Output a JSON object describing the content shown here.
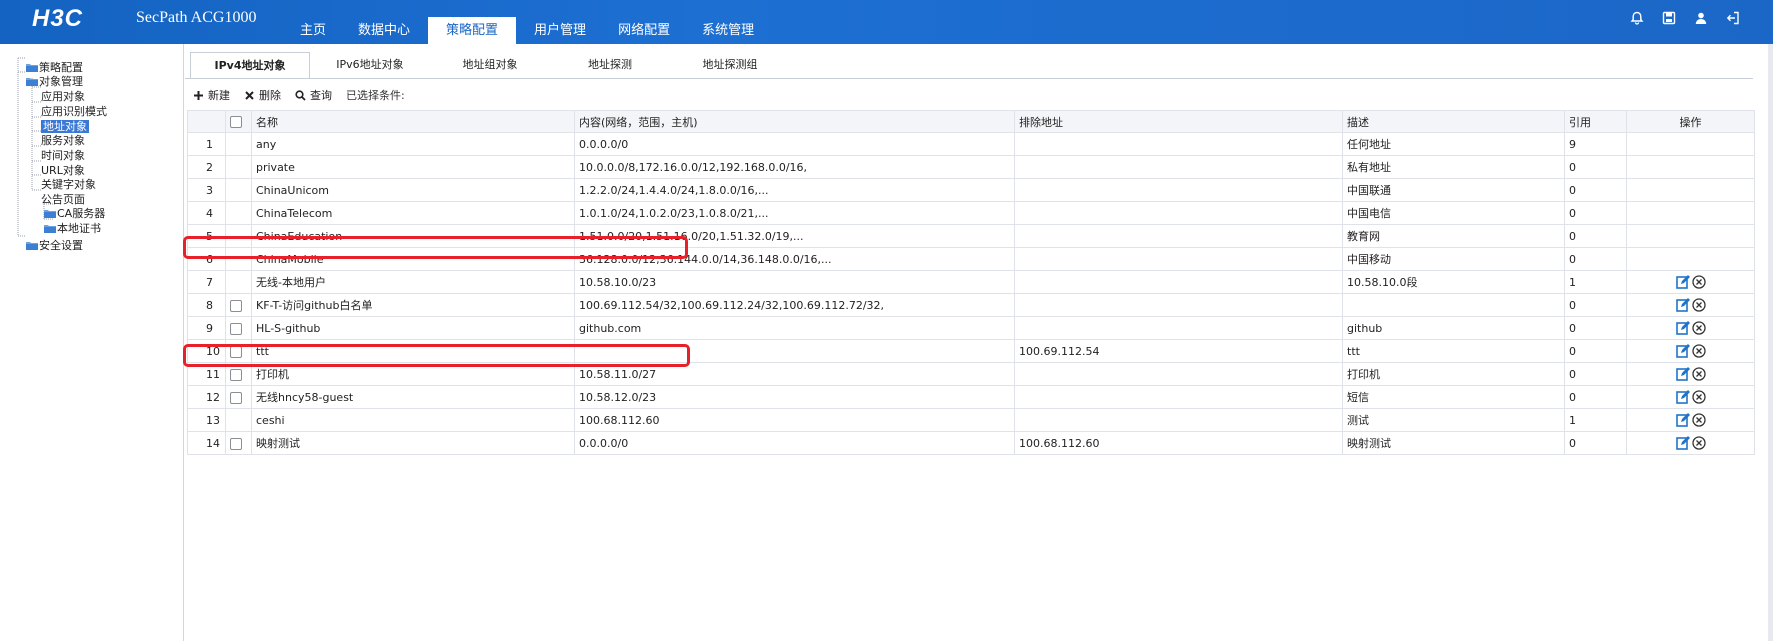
{
  "header": {
    "logo_text": "H3C",
    "product": "SecPath ACG1000",
    "nav": [
      {
        "label": "主页",
        "active": false
      },
      {
        "label": "数据中心",
        "active": false
      },
      {
        "label": "策略配置",
        "active": true
      },
      {
        "label": "用户管理",
        "active": false
      },
      {
        "label": "网络配置",
        "active": false
      },
      {
        "label": "系统管理",
        "active": false
      }
    ],
    "icons": [
      "bell-icon",
      "save-icon",
      "user-icon",
      "logout-icon"
    ]
  },
  "sidebar": {
    "items": [
      {
        "label": "策略配置",
        "level": 0
      },
      {
        "label": "对象管理",
        "level": 0
      },
      {
        "label": "应用对象",
        "level": 1
      },
      {
        "label": "应用识别模式",
        "level": 1
      },
      {
        "label": "地址对象",
        "level": 1,
        "selected": true
      },
      {
        "label": "服务对象",
        "level": 1
      },
      {
        "label": "时间对象",
        "level": 1
      },
      {
        "label": "URL对象",
        "level": 1
      },
      {
        "label": "关键字对象",
        "level": 1
      },
      {
        "label": "公告页面",
        "level": 1
      },
      {
        "label": "CA服务器",
        "level": 2
      },
      {
        "label": "本地证书",
        "level": 2
      },
      {
        "label": "安全设置",
        "level": 0
      }
    ]
  },
  "tabs": [
    "IPv4地址对象",
    "IPv6地址对象",
    "地址组对象",
    "地址探测",
    "地址探测组"
  ],
  "toolbar": {
    "new_label": "新建",
    "delete_label": "删除",
    "query_label": "查询",
    "selected_label": "已选择条件:"
  },
  "table": {
    "headers": [
      "名称",
      "内容(网络，范围，主机)",
      "排除地址",
      "描述",
      "引用",
      "操作"
    ],
    "rows": [
      {
        "no": "1",
        "checkbox": false,
        "name": "any",
        "content": "0.0.0.0/0",
        "exclude": "",
        "desc": "任何地址",
        "ref": "9",
        "ops": false
      },
      {
        "no": "2",
        "checkbox": false,
        "name": "private",
        "content": "10.0.0.0/8,172.16.0.0/12,192.168.0.0/16,",
        "exclude": "",
        "desc": "私有地址",
        "ref": "0",
        "ops": false
      },
      {
        "no": "3",
        "checkbox": false,
        "name": "ChinaUnicom",
        "content": "1.2.2.0/24,1.4.4.0/24,1.8.0.0/16,...",
        "exclude": "",
        "desc": "中国联通",
        "ref": "0",
        "ops": false
      },
      {
        "no": "4",
        "checkbox": false,
        "name": "ChinaTelecom",
        "content": "1.0.1.0/24,1.0.2.0/23,1.0.8.0/21,...",
        "exclude": "",
        "desc": "中国电信",
        "ref": "0",
        "ops": false
      },
      {
        "no": "5",
        "checkbox": false,
        "name": "ChinaEducation",
        "content": "1.51.0.0/20,1.51.16.0/20,1.51.32.0/19,...",
        "exclude": "",
        "desc": "教育网",
        "ref": "0",
        "ops": false
      },
      {
        "no": "6",
        "checkbox": false,
        "name": "ChinaMobile",
        "content": "36.128.0.0/12,36.144.0.0/14,36.148.0.0/16,...",
        "exclude": "",
        "desc": "中国移动",
        "ref": "0",
        "ops": false
      },
      {
        "no": "7",
        "checkbox": false,
        "name": "无线-本地用户",
        "content": "10.58.10.0/23",
        "exclude": "",
        "desc": "10.58.10.0段",
        "ref": "1",
        "ops": true
      },
      {
        "no": "8",
        "checkbox": true,
        "name": "KF-T-访问github白名单",
        "content": "100.69.112.54/32,100.69.112.24/32,100.69.112.72/32,",
        "exclude": "",
        "desc": "",
        "ref": "0",
        "ops": true
      },
      {
        "no": "9",
        "checkbox": true,
        "name": "HL-S-github",
        "content": "github.com",
        "exclude": "",
        "desc": "github",
        "ref": "0",
        "ops": true
      },
      {
        "no": "10",
        "checkbox": true,
        "name": "ttt",
        "content": "",
        "exclude": "100.69.112.54",
        "desc": "ttt",
        "ref": "0",
        "ops": true
      },
      {
        "no": "11",
        "checkbox": true,
        "name": "打印机",
        "content": "10.58.11.0/27",
        "exclude": "",
        "desc": "打印机",
        "ref": "0",
        "ops": true
      },
      {
        "no": "12",
        "checkbox": true,
        "name": "无线hncy58-guest",
        "content": "10.58.12.0/23",
        "exclude": "",
        "desc": "短信",
        "ref": "0",
        "ops": true
      },
      {
        "no": "13",
        "checkbox": false,
        "name": "ceshi",
        "content": "100.68.112.60",
        "exclude": "",
        "desc": "测试",
        "ref": "1",
        "ops": true
      },
      {
        "no": "14",
        "checkbox": true,
        "name": "映射测试",
        "content": "0.0.0.0/0",
        "exclude": "100.68.112.60",
        "desc": "映射测试",
        "ref": "0",
        "ops": true
      }
    ]
  },
  "colors": {
    "header_bg": "#1b67c8",
    "highlight": "#e8202a",
    "edit_icon": "#1f74c8",
    "selected_tree": "#3a78d6"
  }
}
